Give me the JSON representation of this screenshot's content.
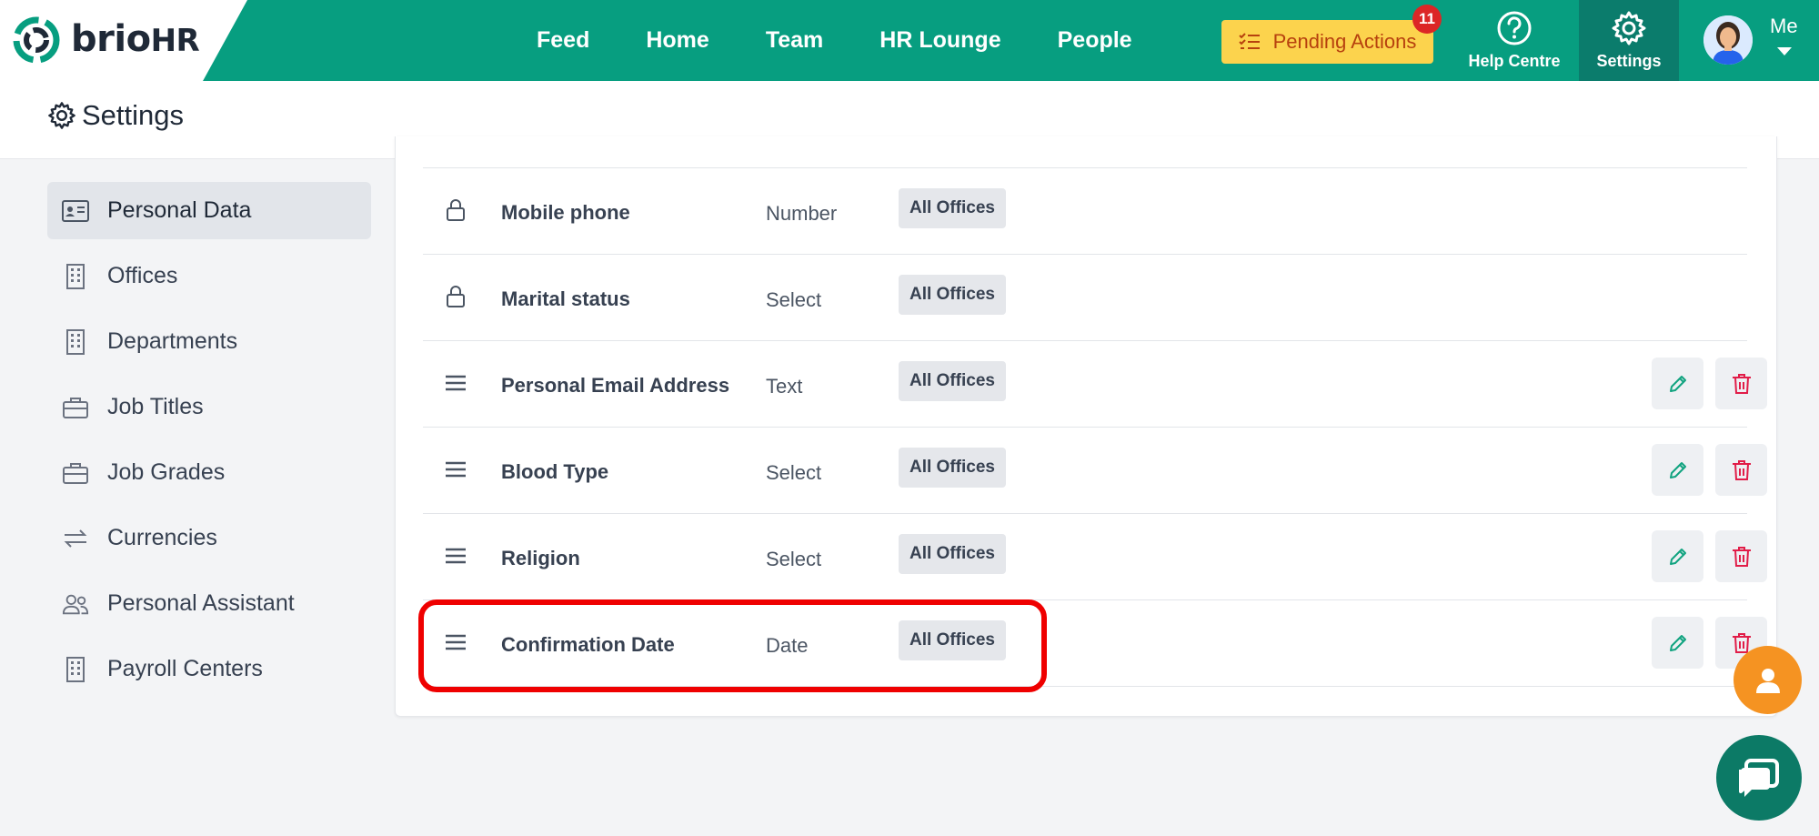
{
  "brand": {
    "name": "brio",
    "suffix": "HR",
    "color": "#079e80"
  },
  "nav": {
    "links": [
      "Feed",
      "Home",
      "Team",
      "HR Lounge",
      "People"
    ],
    "pending_label": "Pending Actions",
    "pending_count": "11",
    "help_label": "Help Centre",
    "settings_label": "Settings",
    "me_label": "Me"
  },
  "page": {
    "title": "Settings"
  },
  "sidebar": {
    "items": [
      {
        "label": "Personal Data",
        "icon": "id-card-icon",
        "active": true
      },
      {
        "label": "Offices",
        "icon": "building-icon"
      },
      {
        "label": "Departments",
        "icon": "building-icon"
      },
      {
        "label": "Job Titles",
        "icon": "briefcase-icon"
      },
      {
        "label": "Job Grades",
        "icon": "briefcase-icon"
      },
      {
        "label": "Currencies",
        "icon": "swap-arrows-icon"
      },
      {
        "label": "Personal Assistant",
        "icon": "users-icon"
      },
      {
        "label": "Payroll Centers",
        "icon": "building-icon"
      }
    ]
  },
  "fields": {
    "rows": [
      {
        "name": "Mobile phone",
        "type": "Number",
        "offices": "All Offices",
        "locked": true
      },
      {
        "name": "Marital status",
        "type": "Select",
        "offices": "All Offices",
        "locked": true
      },
      {
        "name": "Personal Email Address",
        "type": "Text",
        "offices": "All Offices",
        "locked": false
      },
      {
        "name": "Blood Type",
        "type": "Select",
        "offices": "All Offices",
        "locked": false
      },
      {
        "name": "Religion",
        "type": "Select",
        "offices": "All Offices",
        "locked": false
      },
      {
        "name": "Confirmation Date",
        "type": "Date",
        "offices": "All Offices",
        "locked": false,
        "highlighted": true
      }
    ]
  },
  "colors": {
    "accent": "#079e80",
    "pending_bg": "#fcd34d",
    "pending_text": "#b7410e",
    "badge": "#dc2626",
    "delete": "#e11d48",
    "edit": "#10a37f",
    "highlight": "#ef0000",
    "fab_person": "#f59322",
    "fab_chat": "#0c7a66"
  }
}
